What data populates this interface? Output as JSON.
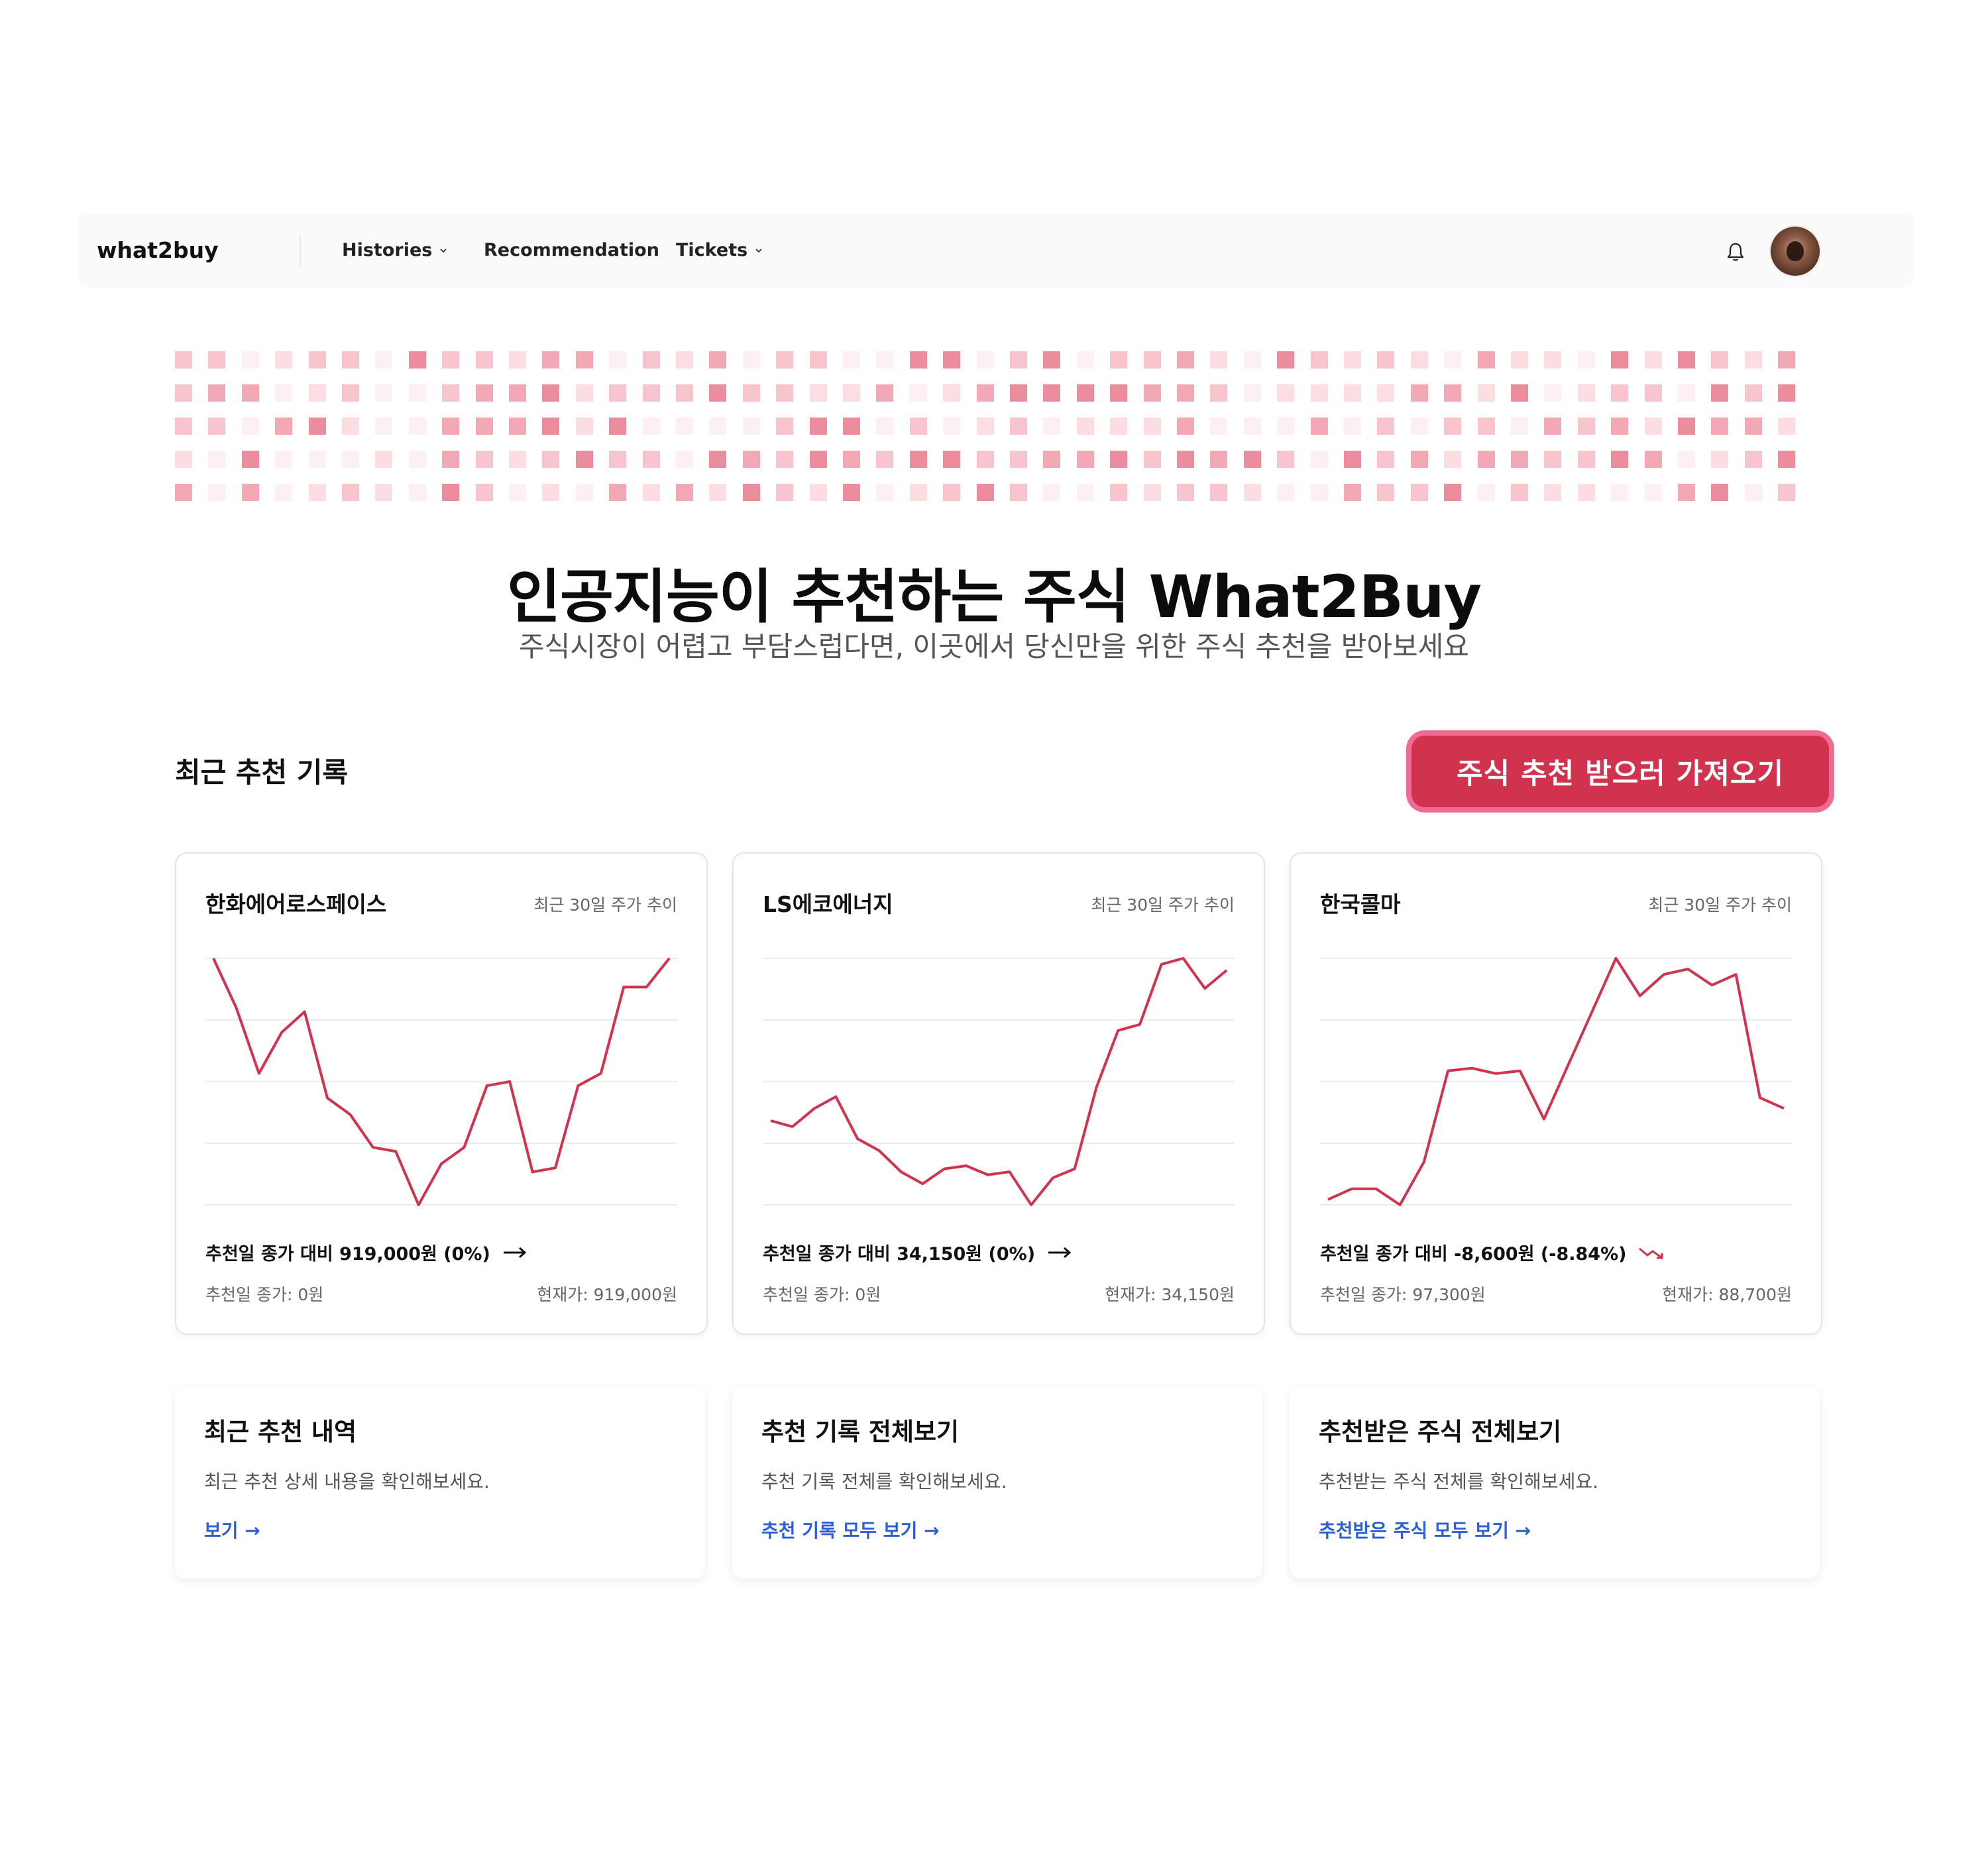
{
  "nav": {
    "brand": "what2buy",
    "items": [
      {
        "label": "Histories",
        "has_dropdown": true
      },
      {
        "label": "Recommendation",
        "has_dropdown": false
      },
      {
        "label": "Tickets",
        "has_dropdown": true
      }
    ],
    "icons": [
      "bell-icon",
      "user-avatar"
    ]
  },
  "hero": {
    "title": "인공지능이 추천하는 주식 What2Buy",
    "subtitle": "주식시장이 어렵고 부담스럽다면, 이곳에서 당신만을 위한 주식 추천을 받아보세요"
  },
  "section": {
    "title": "최근 추천 기록",
    "cta_label": "주식 추천 받으러 가져오기"
  },
  "colors": {
    "accent": "#d1334f",
    "accent_glow": "#f06b92",
    "line": "#d1334f",
    "link": "#2b5fd9"
  },
  "stock_cards": [
    {
      "name": "한화에어로스페이스",
      "meta": "최근 30일 주가 추이",
      "change_text": "추천일 종가 대비 919,000원 (0%)",
      "trend": "flat",
      "close_text": "추천일 종가: 0원",
      "current_text": "현재가: 919,000원",
      "chart_data": {
        "type": "line",
        "series": [
          {
            "values": [
              100,
              88,
              72,
              82,
              87,
              66,
              62,
              54,
              53,
              40,
              50,
              54,
              69,
              70,
              48,
              49,
              69,
              72,
              93,
              93,
              100
            ]
          }
        ],
        "ylim": [
          40,
          100
        ],
        "grid": true
      }
    },
    {
      "name": "LS에코에너지",
      "meta": "최근 30일 주가 추이",
      "change_text": "추천일 종가 대비 34,150원 (0%)",
      "trend": "flat",
      "close_text": "추천일 종가: 0원",
      "current_text": "현재가: 34,150원",
      "chart_data": {
        "type": "line",
        "series": [
          {
            "values": [
              48,
              46,
              52,
              56,
              42,
              38,
              31,
              27,
              32,
              33,
              30,
              31,
              20,
              29,
              32,
              59,
              78,
              80,
              100,
              102,
              92,
              98
            ]
          }
        ],
        "ylim": [
          20,
          102
        ],
        "grid": true
      }
    },
    {
      "name": "한국콜마",
      "meta": "최근 30일 주가 추이",
      "change_text": "추천일 종가 대비 -8,600원 (-8.84%)",
      "trend": "down",
      "close_text": "추천일 종가: 97,300원",
      "current_text": "현재가: 88,700원",
      "chart_data": {
        "type": "line",
        "series": [
          {
            "values": [
              60,
              62,
              62,
              59,
              67,
              84,
              84.5,
              83.5,
              84,
              75,
              85,
              95,
              105,
              98,
              102,
              103,
              100,
              102,
              79,
              77
            ]
          }
        ],
        "ylim": [
          59,
          105
        ],
        "grid": true
      }
    }
  ],
  "link_cards": [
    {
      "title": "최근 추천 내역",
      "desc": "최근 추천 상세 내용을 확인해보세요.",
      "link": "보기 →"
    },
    {
      "title": "추천 기록 전체보기",
      "desc": "추천 기록 전체를 확인해보세요.",
      "link": "추천 기록 모두 보기 →"
    },
    {
      "title": "추천받은 주식 전체보기",
      "desc": "추천받는 주식 전체를 확인해보세요.",
      "link": "추천받은 주식 모두 보기 →"
    }
  ]
}
